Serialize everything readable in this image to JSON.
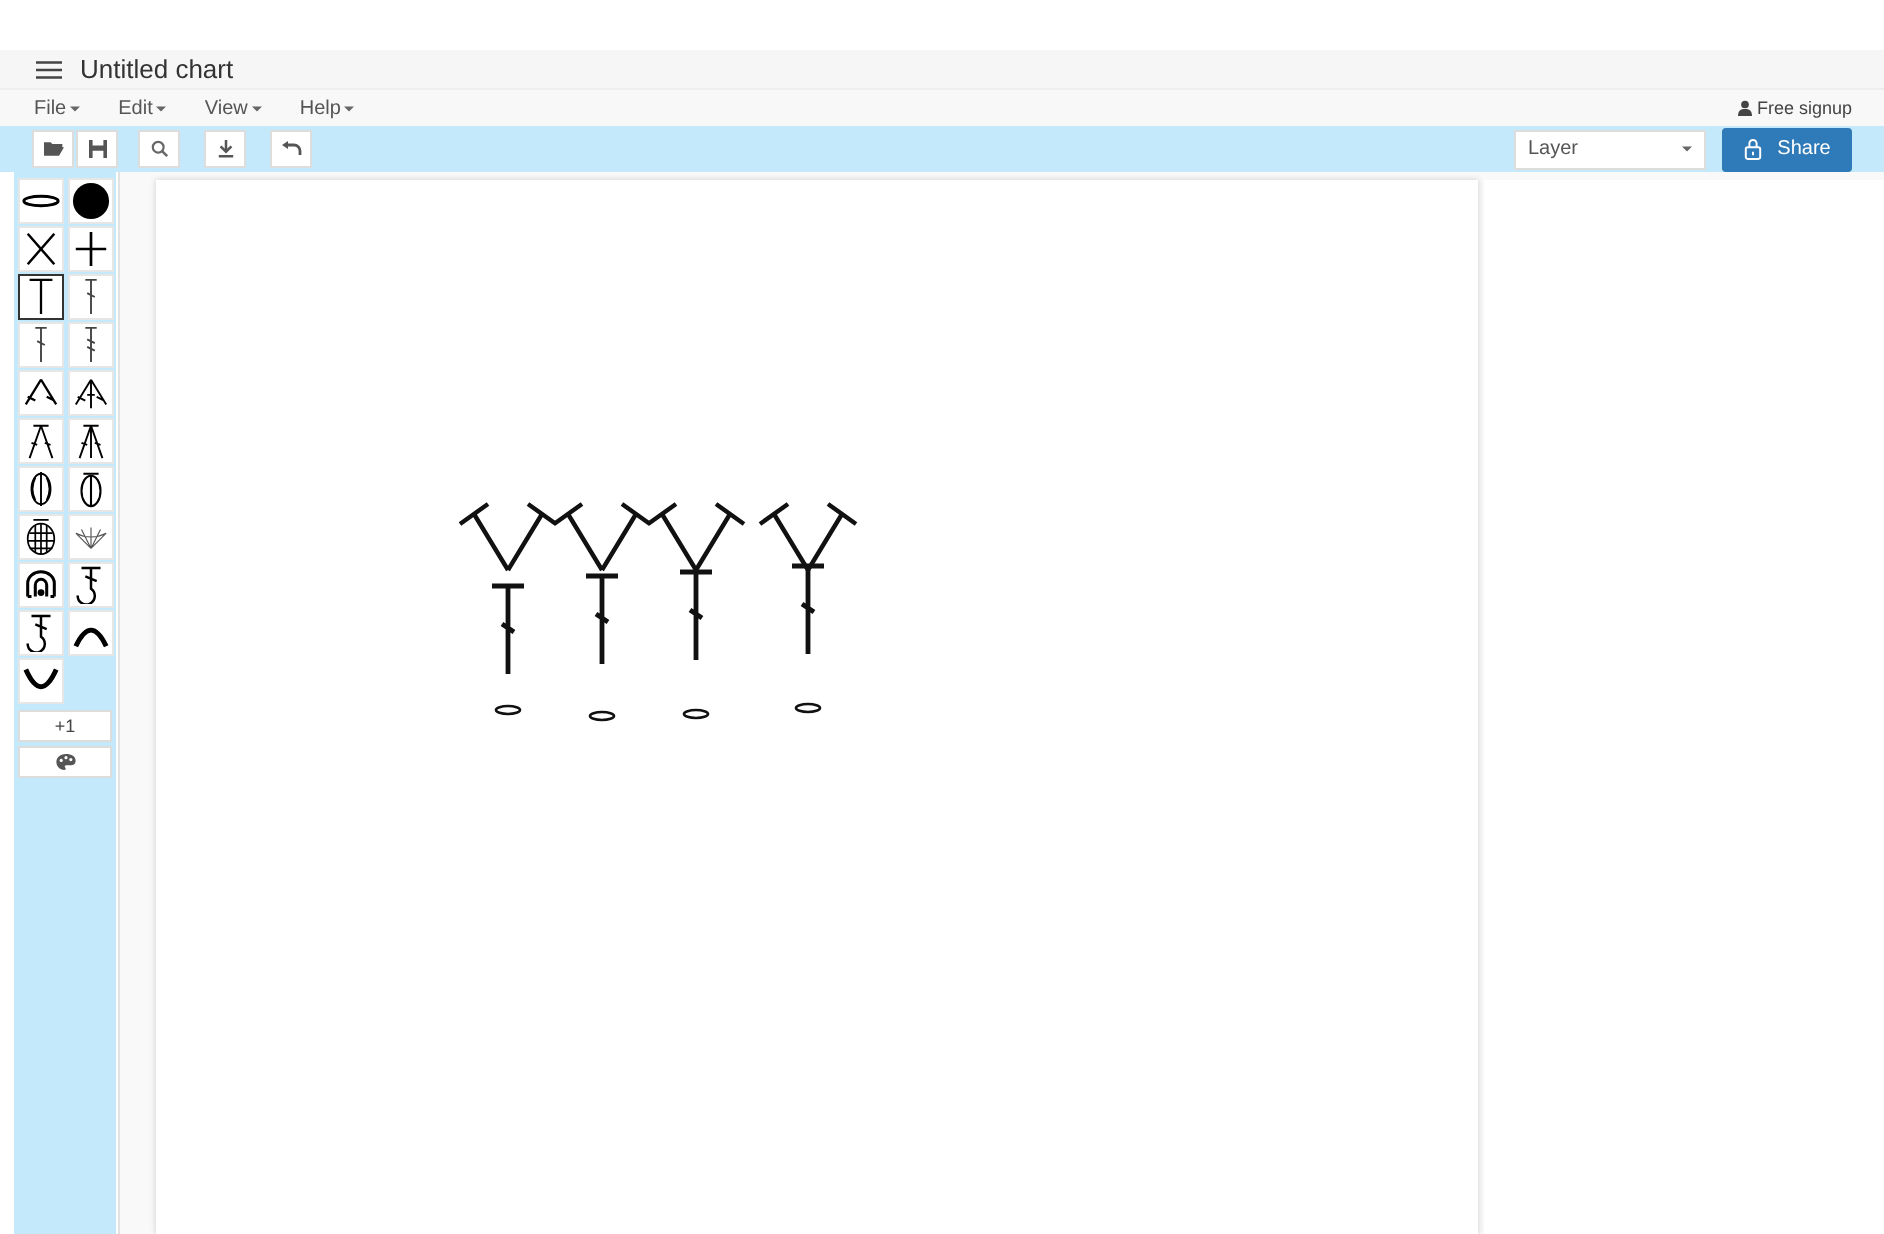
{
  "window": {
    "title": "Untitled chart"
  },
  "menu": [
    {
      "label": "File"
    },
    {
      "label": "Edit"
    },
    {
      "label": "View"
    },
    {
      "label": "Help"
    }
  ],
  "account": {
    "label": "Free signup"
  },
  "toolbar": {
    "layer_select": {
      "value": "Layer"
    },
    "share_button": {
      "label": "Share"
    }
  },
  "palette": [
    {
      "kind": "chain",
      "selected": false
    },
    {
      "kind": "slip",
      "selected": false
    },
    {
      "kind": "cross",
      "selected": false
    },
    {
      "kind": "plus",
      "selected": false
    },
    {
      "kind": "tall",
      "selected": true
    },
    {
      "kind": "dc",
      "selected": false
    },
    {
      "kind": "dc",
      "selected": false
    },
    {
      "kind": "tr",
      "selected": false
    },
    {
      "kind": "inc",
      "selected": false
    },
    {
      "kind": "inc3",
      "selected": false
    },
    {
      "kind": "dec",
      "selected": false
    },
    {
      "kind": "dec3",
      "selected": false
    },
    {
      "kind": "puff",
      "selected": false
    },
    {
      "kind": "oval",
      "selected": false
    },
    {
      "kind": "popcorn",
      "selected": false
    },
    {
      "kind": "fan",
      "selected": false
    },
    {
      "kind": "bobble",
      "selected": false
    },
    {
      "kind": "hook",
      "selected": false
    },
    {
      "kind": "hook",
      "selected": false
    },
    {
      "kind": "arch",
      "selected": false
    },
    {
      "kind": "cup",
      "selected": false
    }
  ],
  "counter_button": {
    "label": "+1"
  },
  "chart": {
    "rows": [
      {
        "stitches": [
          {
            "kind": "v"
          },
          {
            "kind": "v"
          },
          {
            "kind": "v"
          },
          {
            "kind": "v"
          }
        ]
      },
      {
        "stitches": [
          {
            "kind": "dc"
          },
          {
            "kind": "dc"
          },
          {
            "kind": "dc"
          },
          {
            "kind": "dc"
          }
        ]
      },
      {
        "stitches": [
          {
            "kind": "chain"
          },
          {
            "kind": "chain"
          },
          {
            "kind": "chain"
          },
          {
            "kind": "chain"
          }
        ]
      }
    ]
  }
}
